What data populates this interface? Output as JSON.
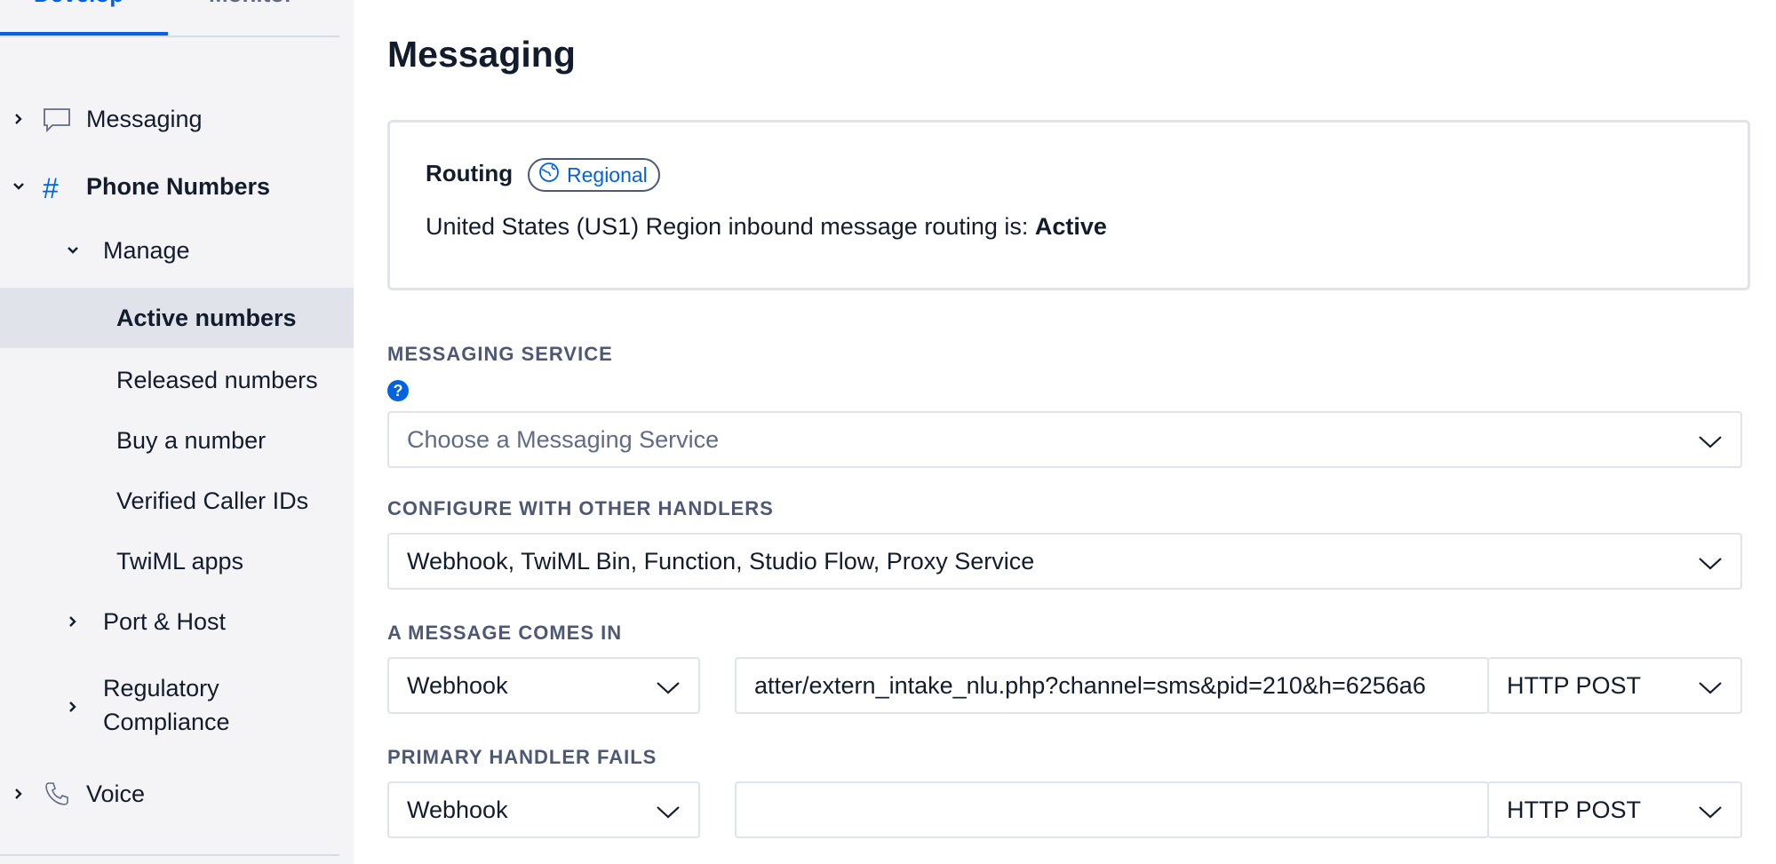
{
  "sidebar": {
    "tabs": {
      "develop": "Develop",
      "monitor": "Monitor"
    },
    "items": {
      "messaging": "Messaging",
      "phone_numbers": "Phone Numbers",
      "manage": "Manage",
      "active_numbers": "Active numbers",
      "released_numbers": "Released numbers",
      "buy_a_number": "Buy a number",
      "verified_caller_ids": "Verified Caller IDs",
      "twiml_apps": "TwiML apps",
      "port_host": "Port & Host",
      "regulatory_line1": "Regulatory",
      "regulatory_line2": "Compliance",
      "voice": "Voice"
    }
  },
  "main": {
    "title": "Messaging",
    "routing": {
      "label": "Routing",
      "badge": "Regional",
      "status_prefix": "United States (US1) Region inbound message routing is: ",
      "status_value": "Active"
    },
    "messaging_service": {
      "label": "MESSAGING SERVICE",
      "help": "?",
      "placeholder": "Choose a Messaging Service"
    },
    "configure": {
      "label": "CONFIGURE WITH OTHER HANDLERS",
      "value": "Webhook, TwiML Bin, Function, Studio Flow, Proxy Service"
    },
    "message_comes_in": {
      "label": "A MESSAGE COMES IN",
      "type": "Webhook",
      "url": "atter/extern_intake_nlu.php?channel=sms&pid=210&h=6256a6",
      "method": "HTTP POST"
    },
    "primary_handler_fails": {
      "label": "PRIMARY HANDLER FAILS",
      "type": "Webhook",
      "url": "",
      "method": "HTTP POST"
    }
  },
  "colors": {
    "accent": "#0263e0",
    "sidebar_bg": "#f4f4f6",
    "active_bg": "#e1e3ea"
  }
}
